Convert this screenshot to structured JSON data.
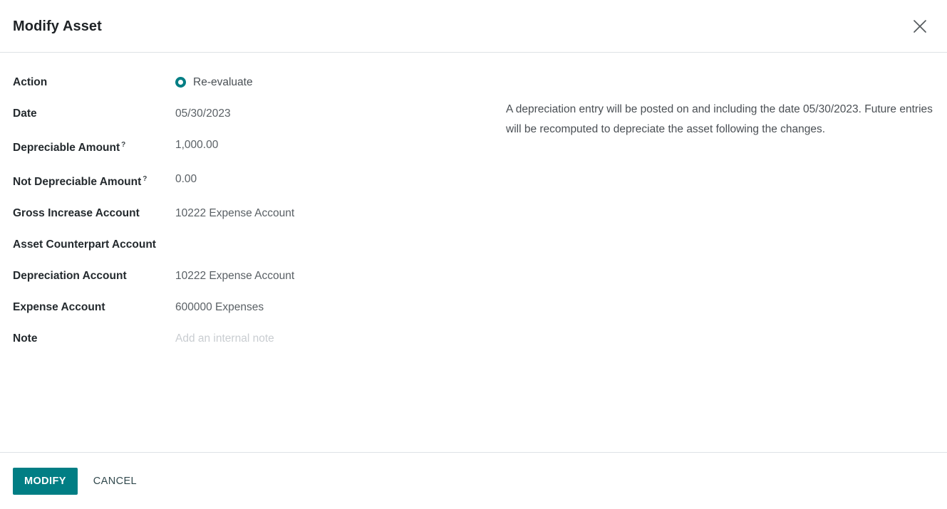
{
  "dialog": {
    "title": "Modify Asset",
    "close_icon": "close-icon"
  },
  "form": {
    "action": {
      "label": "Action",
      "options": [
        {
          "label": "Re-evaluate",
          "selected": true
        }
      ]
    },
    "rows": [
      {
        "label": "Date",
        "tooltip": "",
        "value": "05/30/2023",
        "placeholder": ""
      },
      {
        "label": "Depreciable Amount",
        "tooltip": "?",
        "value": "1,000.00",
        "placeholder": ""
      },
      {
        "label": "Not Depreciable Amount",
        "tooltip": "?",
        "value": "0.00",
        "placeholder": ""
      },
      {
        "label": "Gross Increase Account",
        "tooltip": "",
        "value": "10222 Expense Account",
        "placeholder": ""
      },
      {
        "label": "Asset Counterpart Account",
        "tooltip": "",
        "value": "",
        "placeholder": ""
      },
      {
        "label": "Depreciation Account",
        "tooltip": "",
        "value": "10222 Expense Account",
        "placeholder": ""
      },
      {
        "label": "Expense Account",
        "tooltip": "",
        "value": "600000 Expenses",
        "placeholder": ""
      },
      {
        "label": "Note",
        "tooltip": "",
        "value": "",
        "placeholder": "Add an internal note"
      }
    ]
  },
  "info": {
    "text": "A depreciation entry will be posted on and including the date 05/30/2023. Future entries will be recomputed to depreciate the asset following the changes."
  },
  "footer": {
    "modify_label": "MODIFY",
    "cancel_label": "CANCEL"
  },
  "colors": {
    "accent": "#017e84",
    "label_text": "#242a2e",
    "value_text": "#5a6065",
    "placeholder_text": "#c9cdd1",
    "divider": "#dee2e6",
    "cancel_text": "#31494d"
  }
}
